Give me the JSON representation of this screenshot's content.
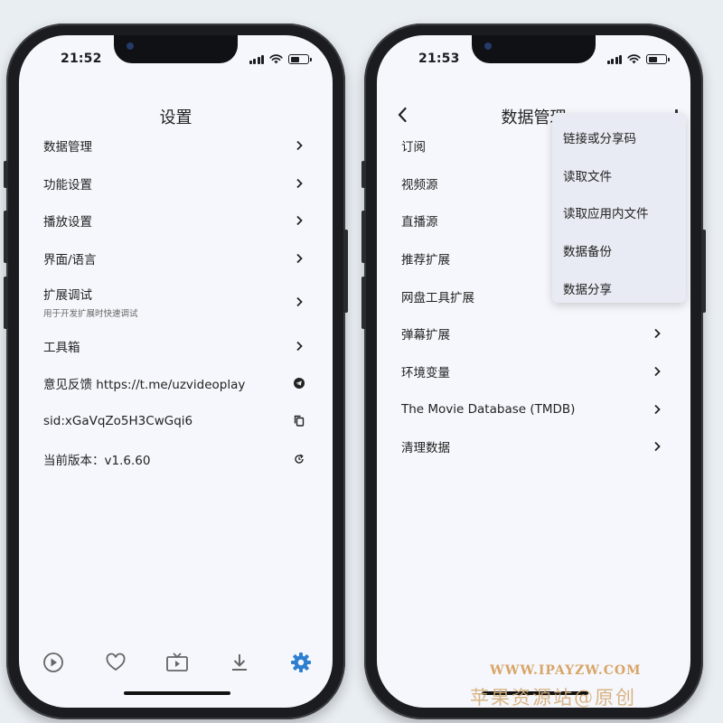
{
  "left_screen": {
    "status": {
      "time": "21:52"
    },
    "title": "设置",
    "items": [
      {
        "label": "数据管理",
        "icon": "chevron-right-icon"
      },
      {
        "label": "功能设置",
        "icon": "chevron-right-icon"
      },
      {
        "label": "播放设置",
        "icon": "chevron-right-icon"
      },
      {
        "label": "界面/语言",
        "icon": "chevron-right-icon"
      },
      {
        "label": "扩展调试",
        "sublabel": "用于开发扩展时快速调试",
        "icon": "chevron-right-icon"
      },
      {
        "label": "工具箱",
        "icon": "chevron-right-icon"
      },
      {
        "label": "意见反馈 https://t.me/uzvideoplay",
        "icon": "telegram-icon"
      },
      {
        "label": "sid:xGaVqZo5H3CwGqi6",
        "icon": "copy-icon"
      },
      {
        "label": "当前版本：v1.6.60",
        "icon": "refresh-icon"
      }
    ],
    "bottom_nav": [
      {
        "icon": "play-icon",
        "active": false
      },
      {
        "icon": "heart-icon",
        "active": false
      },
      {
        "icon": "tv-icon",
        "active": false
      },
      {
        "icon": "download-icon",
        "active": false
      },
      {
        "icon": "gear-icon",
        "active": true
      }
    ]
  },
  "right_screen": {
    "status": {
      "time": "21:53"
    },
    "title": "数据管理",
    "items": [
      {
        "label": "订阅",
        "icon": "chevron-right-icon"
      },
      {
        "label": "视频源",
        "icon": "chevron-right-icon"
      },
      {
        "label": "直播源",
        "icon": "chevron-right-icon"
      },
      {
        "label": "推荐扩展",
        "icon": "chevron-right-icon"
      },
      {
        "label": "网盘工具扩展",
        "icon": "chevron-right-icon"
      },
      {
        "label": "弹幕扩展",
        "icon": "chevron-right-icon"
      },
      {
        "label": "环境变量",
        "icon": "chevron-right-icon"
      },
      {
        "label": "The Movie Database (TMDB)",
        "icon": "chevron-right-icon"
      },
      {
        "label": "清理数据",
        "icon": "chevron-right-icon"
      }
    ],
    "popup_menu": [
      {
        "label": "链接或分享码"
      },
      {
        "label": "读取文件"
      },
      {
        "label": "读取应用内文件"
      },
      {
        "label": "数据备份"
      },
      {
        "label": "数据分享"
      }
    ]
  },
  "watermark": {
    "url": "WWW.IPAYZW.COM",
    "name": "苹果资源站@原创"
  },
  "colors": {
    "accent": "#2f7fd1",
    "screen_bg": "#f6f7fc",
    "popup_bg": "#e8ebf3",
    "watermark": "#d7a566"
  }
}
